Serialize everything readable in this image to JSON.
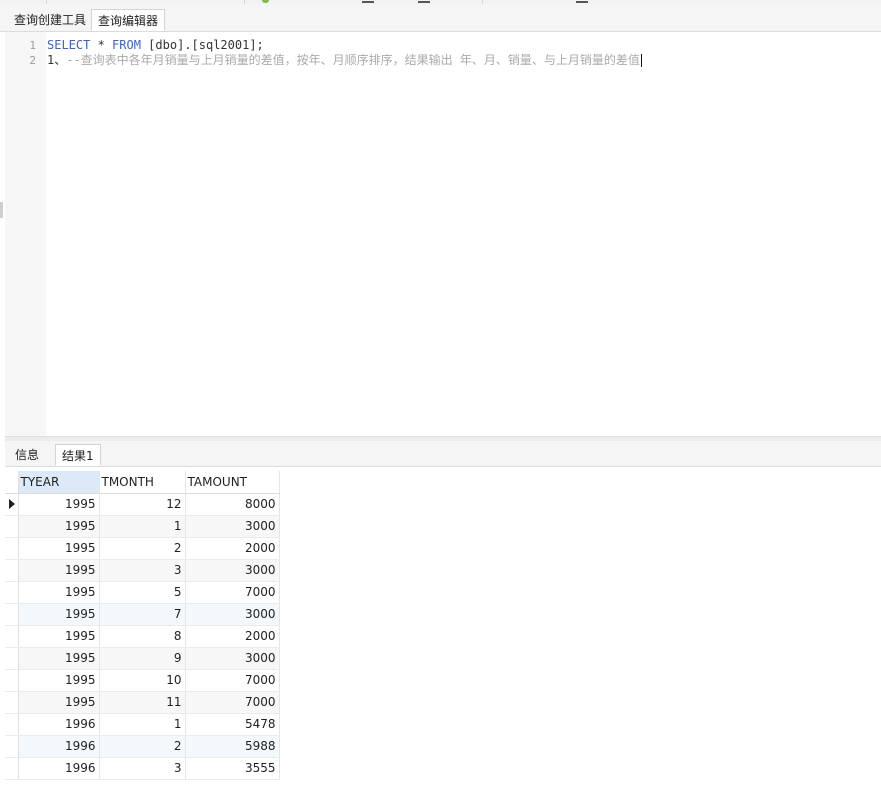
{
  "editor_tabs": [
    {
      "label": "查询创建工具",
      "active": false
    },
    {
      "label": "查询编辑器",
      "active": true
    }
  ],
  "editor": {
    "line_numbers": [
      "1",
      "2"
    ],
    "line1": {
      "kw1": "SELECT",
      "mid": " * ",
      "kw2": "FROM",
      "rest": " [dbo].[sql2001];"
    },
    "line2": {
      "prefix": "1、",
      "comment": "--查询表中各年月销量与上月销量的差值，按年、月顺序排序，结果输出 年、月、销量、与上月销量的差值"
    }
  },
  "result_tabs": [
    {
      "label": "信息",
      "active": false
    },
    {
      "label": "结果1",
      "active": true
    }
  ],
  "grid": {
    "columns": [
      "TYEAR",
      "TMONTH",
      "TAMOUNT"
    ],
    "rows": [
      [
        "1995",
        "12",
        "8000"
      ],
      [
        "1995",
        "1",
        "3000"
      ],
      [
        "1995",
        "2",
        "2000"
      ],
      [
        "1995",
        "3",
        "3000"
      ],
      [
        "1995",
        "5",
        "7000"
      ],
      [
        "1995",
        "7",
        "3000"
      ],
      [
        "1995",
        "8",
        "2000"
      ],
      [
        "1995",
        "9",
        "3000"
      ],
      [
        "1995",
        "10",
        "7000"
      ],
      [
        "1995",
        "11",
        "7000"
      ],
      [
        "1996",
        "1",
        "5478"
      ],
      [
        "1996",
        "2",
        "5988"
      ],
      [
        "1996",
        "3",
        "3555"
      ]
    ]
  },
  "colors": {
    "keyword": "#3b5fd6",
    "comment": "#aaaaaa",
    "selected_header": "#dce9f8"
  }
}
